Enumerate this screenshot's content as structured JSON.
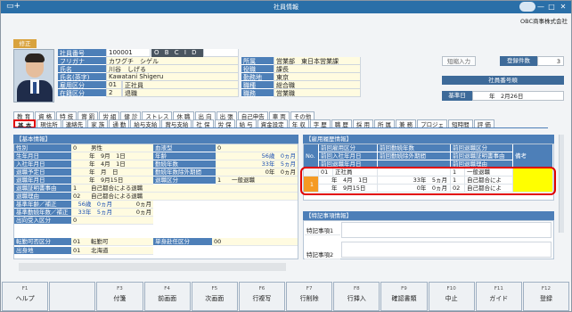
{
  "window": {
    "title": "社員情報",
    "company": "OBC商事株式会社",
    "close_symbol": "✕",
    "maximize_symbol": "□",
    "minimize_symbol": "—"
  },
  "mode_badge": "修正",
  "header": {
    "employee_no_label": "社員番号",
    "employee_no": "100001",
    "obcid_label": "O B C I D",
    "furigana_label": "フリガナ",
    "furigana": "カワグチ　シゲル",
    "name_label": "氏名",
    "name": "川谷　しげる",
    "name_en_label": "氏名(英字)",
    "name_en": "Kawatani Shigeru",
    "employment_type_label": "雇用区分",
    "employment_type_code": "01",
    "employment_type": "正社員",
    "status_label": "在籍区分",
    "status_code": "2",
    "status": "退職",
    "dept_label": "所属",
    "dept": "営業部　東日本営業課",
    "position_label": "役職",
    "position": "課長",
    "location_label": "勤務地",
    "location": "東京",
    "job_type_label": "職種",
    "job_type": "総合職",
    "job_role_label": "職務",
    "job_role": "営業職",
    "short_input": "短縮入力",
    "reg_count_label": "登録件数",
    "reg_count": "3",
    "detail_label": "社員番号順",
    "base_date_label": "基準日",
    "base_date": "年　2月26日"
  },
  "tabs_row1": [
    "教 育",
    "資 格",
    "特 技",
    "賞 罰",
    "労 組",
    "健 診",
    "ストレス",
    "休 職",
    "出 向",
    "出 張",
    "自己申告",
    "車 両",
    "その他"
  ],
  "tabs_row2": [
    "基 本",
    "現住所",
    "連絡先",
    "家 族",
    "通 勤",
    "給与支給",
    "賞与支給",
    "社 保",
    "労 保",
    "給 与",
    "資金設定",
    "年 収",
    "字 歴",
    "職 歴",
    "採 用",
    "所 属",
    "兼 務",
    "プロジェ",
    "短時間",
    "評 価"
  ],
  "basic": {
    "title": "【基本情報】",
    "gender_label": "性別",
    "gender_code": "0",
    "gender": "男性",
    "blood_label": "血液型",
    "blood": "0",
    "birth_label": "生年月日",
    "birth": "年　9月　1日",
    "age_label": "年齢",
    "age": "56歳　0ヵ月",
    "hire_label": "入社年月日",
    "hire": "年　4月　1日",
    "tenure_label": "勤続年数",
    "tenure": "33年　5ヵ月",
    "retire_plan_label": "退職予定日",
    "retire_plan": "年　月　日",
    "tenure_excl_label": "勤続年数除外期間",
    "tenure_excl": "0年　0ヵ月",
    "retire_label": "退職年月日",
    "retire": "年　9月15日",
    "retire_type_label": "退職区分",
    "retire_type_code": "1",
    "retire_type": "一般退職",
    "retire_cert_label": "退職証明書事由",
    "retire_cert_code": "1",
    "retire_cert": "自己都合による退職",
    "retire_reason_label": "退職理由",
    "retire_reason_code": "02",
    "retire_reason": "自己都合による退職",
    "base_age_label": "基準年齢／補正",
    "base_age": "56歳　0ヵ月",
    "base_age_adj": "0ヵ月",
    "base_tenure_label": "基準勤続年数／補正",
    "base_tenure": "33年　5ヵ月",
    "base_tenure_adj": "0ヵ月",
    "dispatch_label": "出向受入区分",
    "dispatch": "0",
    "transfer_label": "転勤可否区分",
    "transfer_code": "01",
    "transfer": "転勤可",
    "single_label": "単身赴任区分",
    "single": "00",
    "origin_label": "出身地",
    "origin_code": "01",
    "origin": "北海道"
  },
  "history": {
    "title": "【雇用履歴情報】",
    "col_no": "No.",
    "col_prev_emp": "前回雇用区分",
    "col_prev_hire": "前回入社年月日",
    "col_prev_excl": "前回勤続除外期間",
    "col_prev_retire_date": "前回退職年月日",
    "col_prev_tenure": "前回勤続年数",
    "col_prev_retire_type": "前回退職区分",
    "col_prev_cert": "前回退職証明書事由",
    "col_prev_reason": "前回退職理由",
    "col_memo": "備考",
    "row": {
      "no": "1",
      "emp_code": "01",
      "emp": "正社員",
      "hire": "年　4月　1日",
      "tenure": "33年　5ヵ月",
      "retire_type_code": "1",
      "retire_type": "一般退職",
      "cert_code": "1",
      "cert": "自己都合によ",
      "retire_date": "年　9月15日",
      "excl": "0年　0ヵ月",
      "reason_code": "02",
      "reason": "自己都合によ"
    }
  },
  "special": {
    "title": "【特記事項情報】",
    "item1": "特記事項1",
    "item2": "特記事項2"
  },
  "fkeys": [
    {
      "code": "F1",
      "label": "ヘルプ"
    },
    {
      "code": "",
      "label": ""
    },
    {
      "code": "F3",
      "label": "付箋"
    },
    {
      "code": "F4",
      "label": "前画面"
    },
    {
      "code": "F5",
      "label": "次画面"
    },
    {
      "code": "F6",
      "label": "行複写"
    },
    {
      "code": "F7",
      "label": "行削除"
    },
    {
      "code": "F8",
      "label": "行挿入"
    },
    {
      "code": "F9",
      "label": "確認書類"
    },
    {
      "code": "F10",
      "label": "中止"
    },
    {
      "code": "F11",
      "label": "ガイド"
    },
    {
      "code": "F12",
      "label": "登録"
    }
  ]
}
